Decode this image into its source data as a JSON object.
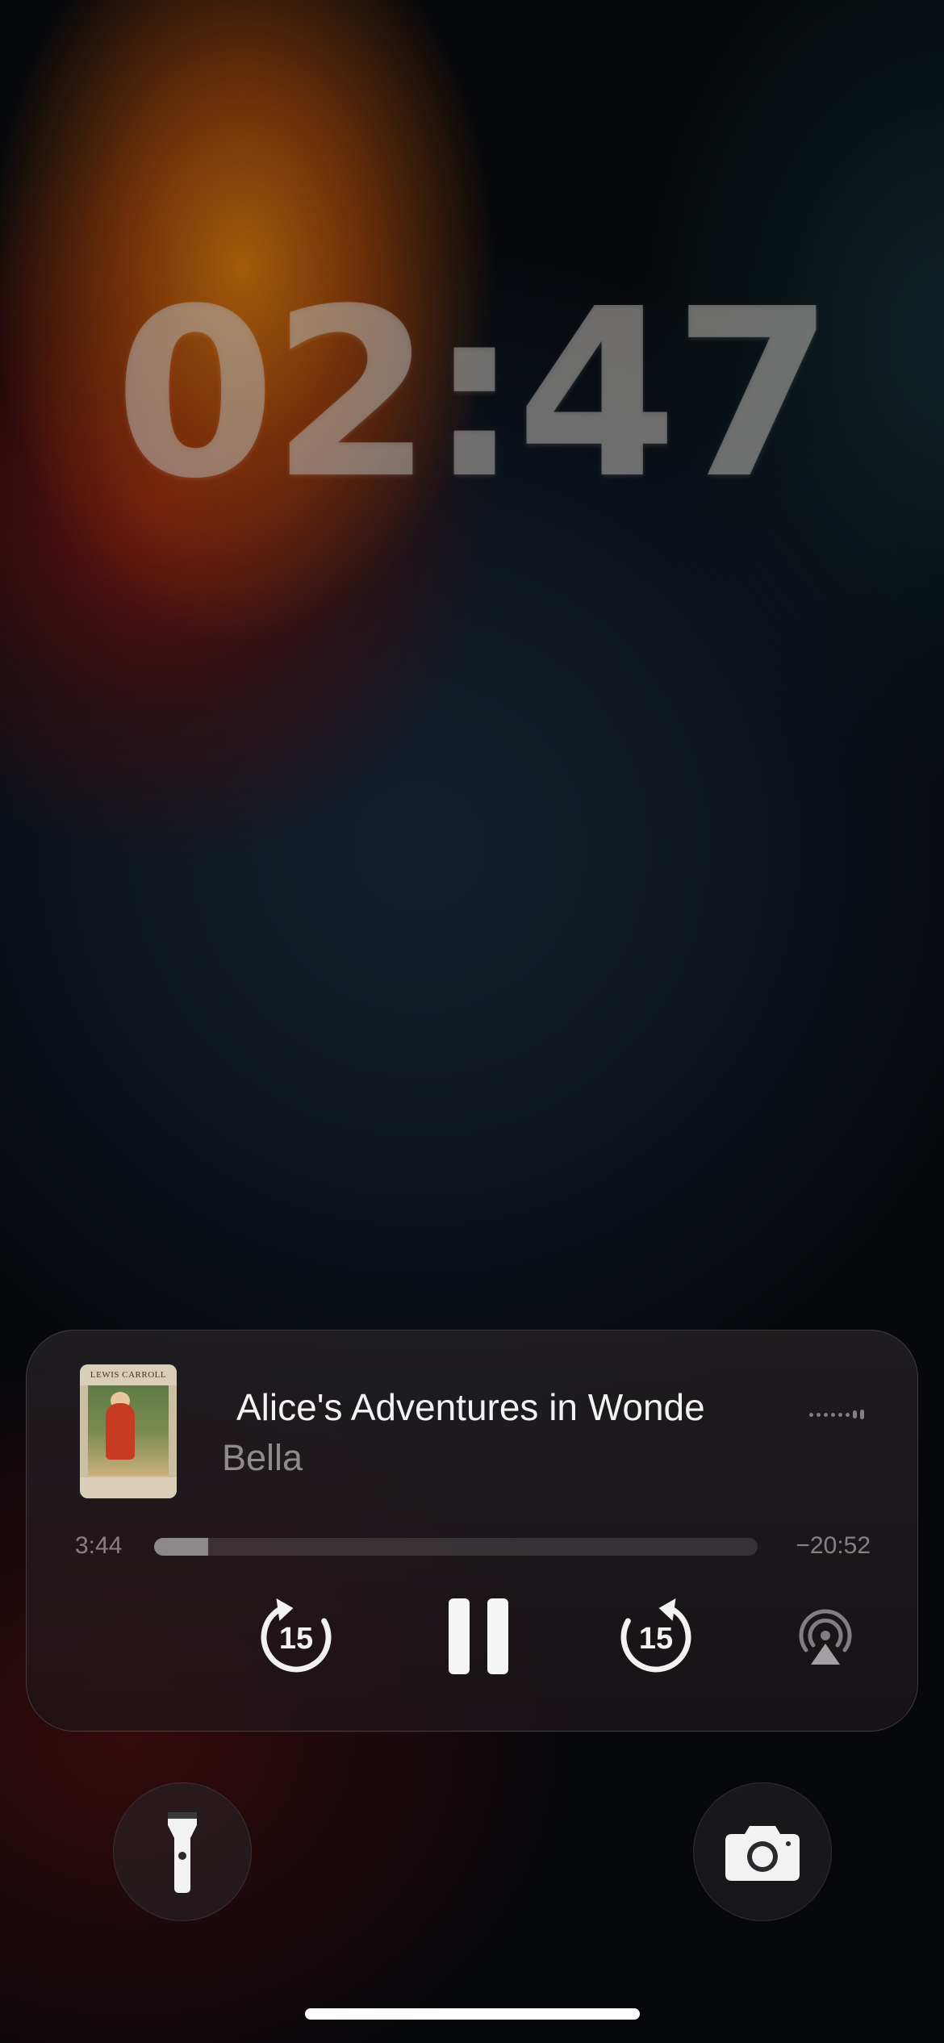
{
  "lock_screen": {
    "time": "02:47"
  },
  "now_playing": {
    "title": "Alice's Adventures in Wonde",
    "artist": "Bella",
    "artwork_text": "LEWIS CARROLL",
    "elapsed": "3:44",
    "remaining": "−20:52",
    "progress_fraction": 0.09,
    "skip_back_seconds": "15",
    "skip_forward_seconds": "15",
    "playback_state": "playing"
  },
  "quick_actions": {
    "left": "flashlight-icon",
    "right": "camera-icon"
  },
  "colors": {
    "clock": "#aaa5a0",
    "accent_white": "#ffffff"
  }
}
